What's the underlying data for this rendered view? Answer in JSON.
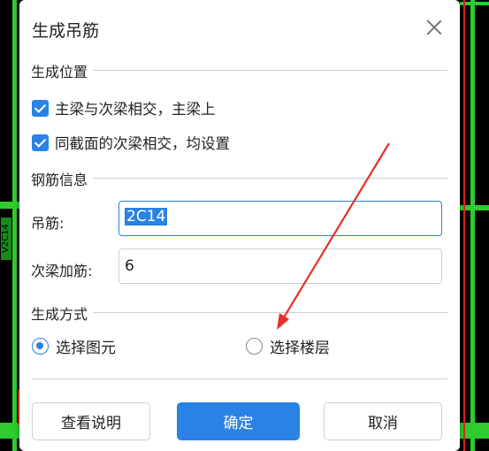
{
  "dialog": {
    "title": "生成吊筋",
    "close_icon": "close-icon"
  },
  "position_section": {
    "label": "生成位置",
    "options": [
      {
        "label": "主梁与次梁相交，主梁上",
        "checked": true
      },
      {
        "label": "同截面的次梁相交，均设置",
        "checked": true
      }
    ]
  },
  "rebar_section": {
    "label": "钢筋信息",
    "hanger_label": "吊筋:",
    "hanger_value": "2C14",
    "secondary_label": "次梁加筋:",
    "secondary_value": "6"
  },
  "method_section": {
    "label": "生成方式",
    "options": [
      {
        "label": "选择图元",
        "selected": true
      },
      {
        "label": "选择楼层",
        "selected": false
      }
    ]
  },
  "buttons": {
    "help": "查看说明",
    "ok": "确定",
    "cancel": "取消"
  },
  "background": {
    "cad_label": "V2C14"
  },
  "colors": {
    "accent": "#2a82e4",
    "cad_green": "#2ecc2e",
    "cad_red": "#e02020",
    "annotation_arrow": "#e8302a"
  }
}
